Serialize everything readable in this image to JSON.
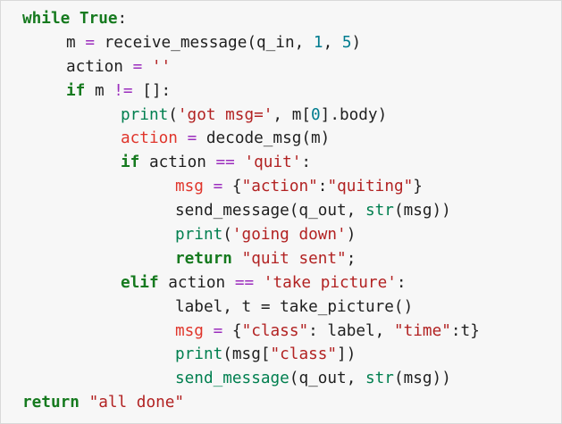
{
  "code": {
    "line1": {
      "kw_while": "while",
      "kw_true": "True",
      "colon": ":"
    },
    "line2": {
      "name": "m",
      "eq": "=",
      "call": "receive_message(q_in, ",
      "n1": "1",
      "sep": ", ",
      "n2": "5",
      "close": ")"
    },
    "line3": {
      "name": "action",
      "eq": "=",
      "value": "''"
    },
    "line4": {
      "kw_if": "if",
      "name": "m",
      "op": "!=",
      "rest": "[]:"
    },
    "line5": {
      "fn": "print",
      "open": "(",
      "str": "'got msg='",
      "comma": ", m[",
      "num": "0",
      "rest": "].body)"
    },
    "line6": {
      "var": "action",
      "eq": "=",
      "rest": "decode_msg(m)"
    },
    "line7": {
      "kw_if": "if",
      "name": "action",
      "eq": "==",
      "str": "'quit'",
      "colon": ":"
    },
    "line8": {
      "var": "msg",
      "eq": "=",
      "open": "{",
      "k": "\"action\"",
      "colon": ":",
      "v": "\"quiting\"",
      "close": "}"
    },
    "line9": {
      "call": "send_message(q_out, ",
      "fn": "str",
      "rest": "(msg))"
    },
    "line10": {
      "fn": "print",
      "open": "(",
      "str": "'going down'",
      "close": ")"
    },
    "line11": {
      "kw": "return",
      "str": "\"quit sent\"",
      "semi": ";"
    },
    "line12": {
      "kw": "elif",
      "name": "action",
      "eq": "==",
      "str": "'take picture'",
      "colon": ":"
    },
    "line13": {
      "text": "label, t = take_picture()"
    },
    "line14": {
      "var": "msg",
      "eq": "=",
      "open": "{",
      "k1": "\"class\"",
      "mid": ": label, ",
      "k2": "\"time\"",
      "colon": ":t",
      "close": "}"
    },
    "line15": {
      "fn": "print",
      "open": "(msg[",
      "str": "\"class\"",
      "close": "])"
    },
    "line16": {
      "call": "send_message",
      "args": "(q_out, ",
      "fn": "str",
      "rest": "(msg))"
    },
    "line17": {
      "kw": "return",
      "str": "\"all done\""
    }
  }
}
